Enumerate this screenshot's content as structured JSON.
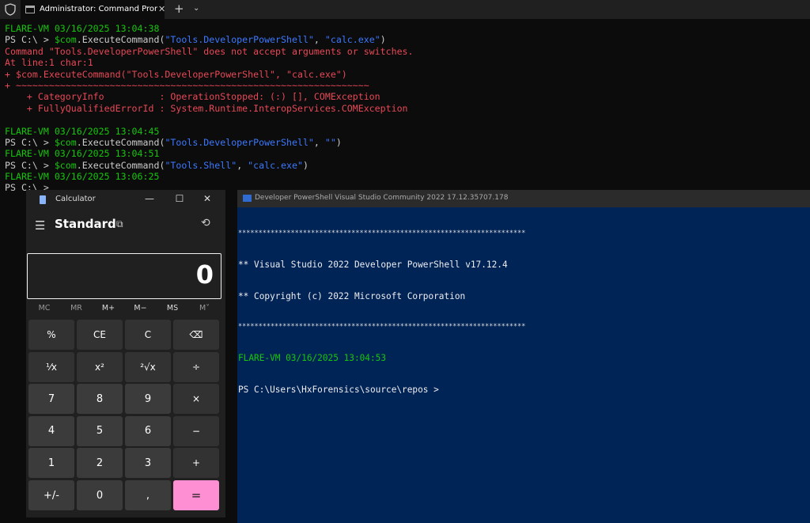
{
  "tabbar": {
    "shield_icon": "shield-icon",
    "tab_label": "Administrator: Command Pror",
    "close": "✕",
    "new_tab": "+",
    "dropdown": "⌄"
  },
  "terminal": {
    "lines": [
      {
        "p1": "FLARE-VM 03/16/2025 13:04:38"
      },
      {
        "prompt": "PS C:\\ > ",
        "var": "$com",
        "method": ".ExecuteCommand(",
        "s1": "\"Tools.DeveloperPowerShell\"",
        "comma": ", ",
        "s2": "\"calc.exe\"",
        "end": ")"
      },
      {
        "err": "Command \"Tools.DeveloperPowerShell\" does not accept arguments or switches."
      },
      {
        "err": "At line:1 char:1"
      },
      {
        "err": "+ $com.ExecuteCommand(\"Tools.DeveloperPowerShell\", \"calc.exe\")"
      },
      {
        "err": "+ ~~~~~~~~~~~~~~~~~~~~~~~~~~~~~~~~~~~~~~~~~~~~~~~~~~~~~~~~~~~~~~~~"
      },
      {
        "err": "    + CategoryInfo          : OperationStopped: (:) [], COMException"
      },
      {
        "err": "    + FullyQualifiedErrorId : System.Runtime.InteropServices.COMException"
      },
      {
        "blank": " "
      },
      {
        "p1": "FLARE-VM 03/16/2025 13:04:45"
      },
      {
        "prompt": "PS C:\\ > ",
        "var": "$com",
        "method": ".ExecuteCommand(",
        "s1": "\"Tools.DeveloperPowerShell\"",
        "comma": ", ",
        "s2": "\"\"",
        "end": ")"
      },
      {
        "p1": "FLARE-VM 03/16/2025 13:04:51"
      },
      {
        "prompt": "PS C:\\ > ",
        "var": "$com",
        "method": ".ExecuteCommand(",
        "s1": "\"Tools.Shell\"",
        "comma": ", ",
        "s2": "\"calc.exe\"",
        "end": ")"
      },
      {
        "p1": "FLARE-VM 03/16/2025 13:06:25"
      },
      {
        "prompt_only": "PS C:\\ >"
      }
    ]
  },
  "calculator": {
    "app_name": "Calculator",
    "minimize": "—",
    "maximize": "☐",
    "close": "✕",
    "menu_icon": "☰",
    "mode": "Standard",
    "keep_on_top_icon": "⧉",
    "history_icon": "⟲",
    "display": "0",
    "memory": [
      "MC",
      "MR",
      "M+",
      "M−",
      "MS",
      "M˅"
    ],
    "keys": [
      [
        "%",
        "CE",
        "C",
        "⌫"
      ],
      [
        "⅟x",
        "x²",
        "²√x",
        "÷"
      ],
      [
        "7",
        "8",
        "9",
        "×"
      ],
      [
        "4",
        "5",
        "6",
        "−"
      ],
      [
        "1",
        "2",
        "3",
        "+"
      ],
      [
        "+/-",
        "0",
        ",",
        "="
      ]
    ],
    "accent": "#ff8fd3"
  },
  "devshell": {
    "title": "Developer PowerShell Visual Studio Community 2022 17.12.35707.178",
    "sep": "***********************************************************************",
    "line1": "** Visual Studio 2022 Developer PowerShell v17.12.4",
    "line2": "** Copyright (c) 2022 Microsoft Corporation",
    "prompt_time": "FLARE-VM 03/16/2025 13:04:53",
    "prompt": "PS C:\\Users\\HxForensics\\source\\repos >",
    "bg": "#012456"
  }
}
